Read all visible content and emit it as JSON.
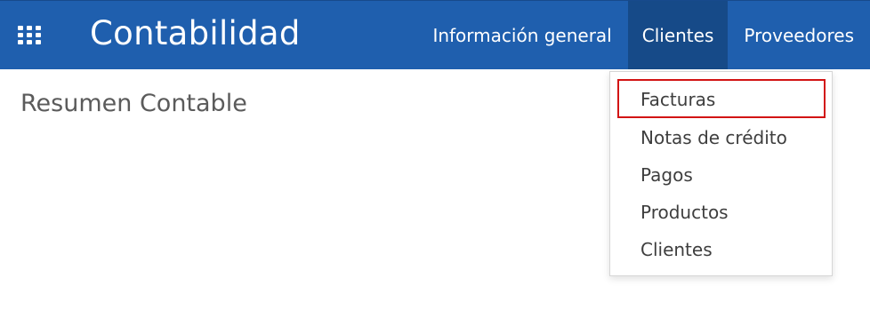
{
  "header": {
    "app_title": "Contabilidad",
    "apps_icon": "grid-apps-icon",
    "background_color": "#1f5fae",
    "active_tab_color": "#164a88"
  },
  "nav": {
    "items": [
      {
        "label": "Información general",
        "active": false
      },
      {
        "label": "Clientes",
        "active": true
      },
      {
        "label": "Proveedores",
        "active": false
      }
    ]
  },
  "page": {
    "title": "Resumen Contable"
  },
  "dropdown": {
    "items": [
      {
        "label": "Facturas",
        "highlighted": true
      },
      {
        "label": "Notas de crédito",
        "highlighted": false
      },
      {
        "label": "Pagos",
        "highlighted": false
      },
      {
        "label": "Productos",
        "highlighted": false
      },
      {
        "label": "Clientes",
        "highlighted": false
      }
    ],
    "highlight_color": "#d21414"
  }
}
